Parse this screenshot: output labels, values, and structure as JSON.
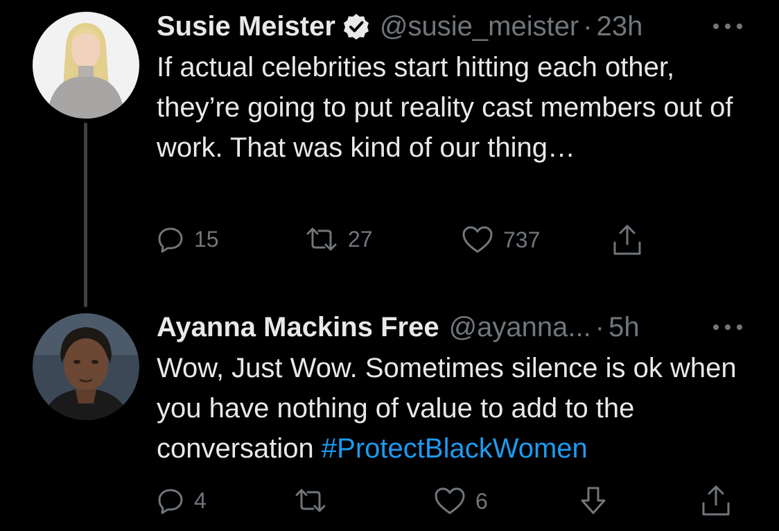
{
  "tweets": [
    {
      "author_name": "Susie Meister",
      "verified": true,
      "handle": "@susie_meister",
      "separator": "·",
      "time": "23h",
      "text": "If actual celebrities start hitting each other, they’re going to put reality cast members out of work. That was kind of our thing…",
      "actions": {
        "replies": "15",
        "retweets": "27",
        "likes": "737"
      }
    },
    {
      "author_name": "Ayanna Mackins Free",
      "verified": false,
      "handle": "@ayanna...",
      "separator": "·",
      "time": "5h",
      "text": "Wow, Just Wow. Sometimes silence is ok when you have nothing of value to add to the conversation ",
      "hashtag": "#ProtectBlackWomen",
      "actions": {
        "replies": "4",
        "retweets": "",
        "likes": "6"
      }
    }
  ],
  "colors": {
    "background": "#000000",
    "primary_text": "#e7e9ea",
    "secondary_text": "#71767b",
    "link": "#1d9bf0",
    "thread_line": "#3e4144"
  }
}
